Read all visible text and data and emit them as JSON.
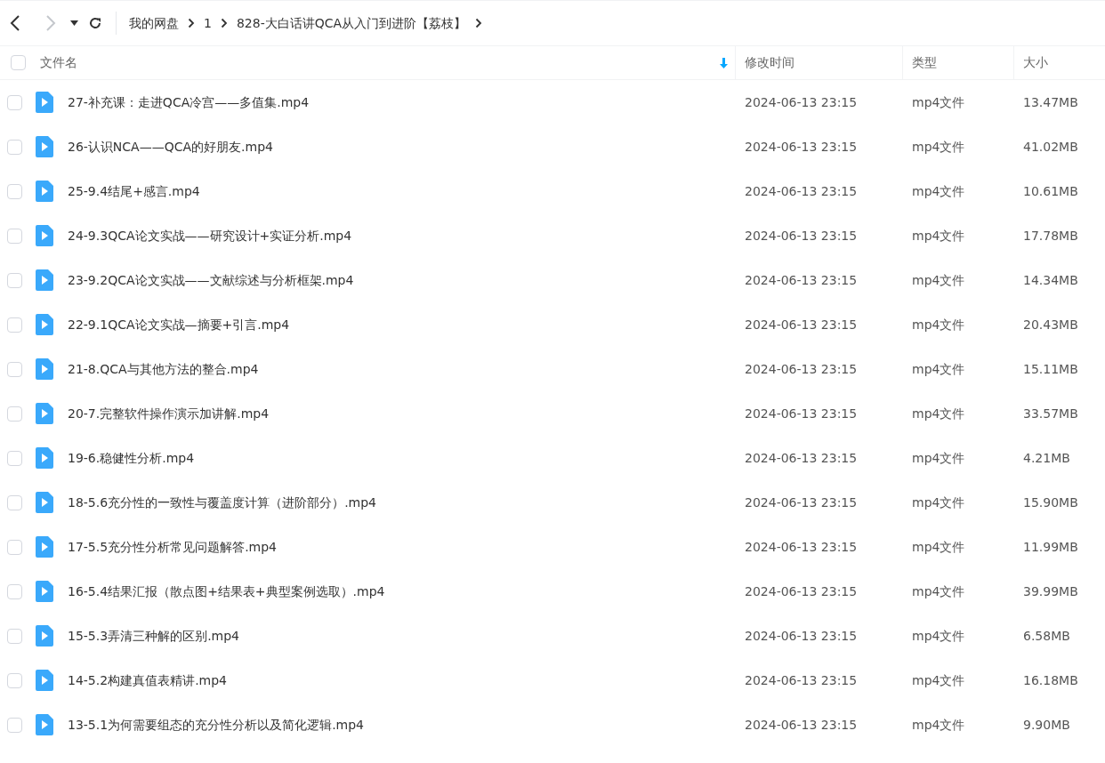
{
  "toolbar": {
    "back_disabled": false,
    "forward_disabled": true,
    "breadcrumbs": [
      "我的网盘",
      "1",
      "828-大白话讲QCA从入门到进阶【荔枝】"
    ]
  },
  "table": {
    "select_all_checked": false,
    "columns": [
      {
        "label": "文件名",
        "sorted": true
      },
      {
        "label": "修改时间",
        "sorted": false
      },
      {
        "label": "类型",
        "sorted": false
      },
      {
        "label": "大小",
        "sorted": false
      }
    ],
    "rows": [
      {
        "checked": false,
        "name": "27-补充课：走进QCA冷宫——多值集.mp4",
        "modified": "2024-06-13 23:15",
        "type": "mp4文件",
        "size": "13.47MB"
      },
      {
        "checked": false,
        "name": "26-认识NCA——QCA的好朋友.mp4",
        "modified": "2024-06-13 23:15",
        "type": "mp4文件",
        "size": "41.02MB"
      },
      {
        "checked": false,
        "name": "25-9.4结尾+感言.mp4",
        "modified": "2024-06-13 23:15",
        "type": "mp4文件",
        "size": "10.61MB"
      },
      {
        "checked": false,
        "name": "24-9.3QCA论文实战——研究设计+实证分析.mp4",
        "modified": "2024-06-13 23:15",
        "type": "mp4文件",
        "size": "17.78MB"
      },
      {
        "checked": false,
        "name": "23-9.2QCA论文实战——文献综述与分析框架.mp4",
        "modified": "2024-06-13 23:15",
        "type": "mp4文件",
        "size": "14.34MB"
      },
      {
        "checked": false,
        "name": "22-9.1QCA论文实战—摘要+引言.mp4",
        "modified": "2024-06-13 23:15",
        "type": "mp4文件",
        "size": "20.43MB"
      },
      {
        "checked": false,
        "name": "21-8.QCA与其他方法的整合.mp4",
        "modified": "2024-06-13 23:15",
        "type": "mp4文件",
        "size": "15.11MB"
      },
      {
        "checked": false,
        "name": "20-7.完整软件操作演示加讲解.mp4",
        "modified": "2024-06-13 23:15",
        "type": "mp4文件",
        "size": "33.57MB"
      },
      {
        "checked": false,
        "name": "19-6.稳健性分析.mp4",
        "modified": "2024-06-13 23:15",
        "type": "mp4文件",
        "size": "4.21MB"
      },
      {
        "checked": false,
        "name": "18-5.6充分性的一致性与覆盖度计算（进阶部分）.mp4",
        "modified": "2024-06-13 23:15",
        "type": "mp4文件",
        "size": "15.90MB"
      },
      {
        "checked": false,
        "name": "17-5.5充分性分析常见问题解答.mp4",
        "modified": "2024-06-13 23:15",
        "type": "mp4文件",
        "size": "11.99MB"
      },
      {
        "checked": false,
        "name": "16-5.4结果汇报（散点图+结果表+典型案例选取）.mp4",
        "modified": "2024-06-13 23:15",
        "type": "mp4文件",
        "size": "39.99MB"
      },
      {
        "checked": false,
        "name": "15-5.3弄清三种解的区别.mp4",
        "modified": "2024-06-13 23:15",
        "type": "mp4文件",
        "size": "6.58MB"
      },
      {
        "checked": false,
        "name": "14-5.2构建真值表精讲.mp4",
        "modified": "2024-06-13 23:15",
        "type": "mp4文件",
        "size": "16.18MB"
      },
      {
        "checked": false,
        "name": "13-5.1为何需要组态的充分性分析以及简化逻辑.mp4",
        "modified": "2024-06-13 23:15",
        "type": "mp4文件",
        "size": "9.90MB"
      }
    ]
  }
}
